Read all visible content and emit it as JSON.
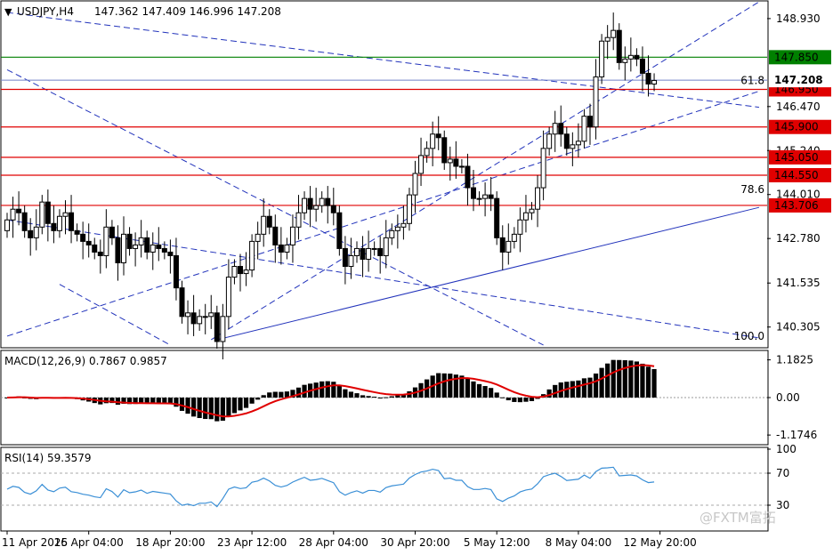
{
  "header": {
    "symbol": "USDJPY,H4",
    "ohlc": "147.362 147.409 146.996 147.208"
  },
  "watermark": "@FXTM富拓",
  "chart_data": {
    "type": "candlestick",
    "price_ticks": [
      "148.930",
      "146.470",
      "145.240",
      "144.010",
      "142.780",
      "141.535",
      "140.305"
    ],
    "price_tick_values": [
      148.93,
      146.47,
      145.24,
      144.01,
      142.78,
      141.535,
      140.305
    ],
    "price_range": [
      139.75,
      149.4
    ],
    "current_price": {
      "label": "147.208",
      "value": 147.208
    },
    "levels": [
      {
        "label": "147.850",
        "value": 147.85,
        "color": "#008000"
      },
      {
        "label": "146.950",
        "value": 146.95,
        "color": "#e00000"
      },
      {
        "label": "145.900",
        "value": 145.9,
        "color": "#e00000"
      },
      {
        "label": "145.050",
        "value": 145.05,
        "color": "#e00000"
      },
      {
        "label": "144.550",
        "value": 144.55,
        "color": "#e00000"
      },
      {
        "label": "143.706",
        "value": 143.706,
        "color": "#e00000"
      }
    ],
    "fib_labels": [
      {
        "label": "61.8",
        "value": 147.05
      },
      {
        "label": "78.6",
        "value": 144.0
      },
      {
        "label": "100.0",
        "value": 139.9
      }
    ],
    "x_labels": [
      "11 Apr 2025",
      "16 Apr 04:00",
      "18 Apr 20:00",
      "23 Apr 12:00",
      "28 Apr 04:00",
      "30 Apr 20:00",
      "5 May 12:00",
      "8 May 04:00",
      "12 May 20:00"
    ],
    "x_label_bar_index": [
      0,
      14,
      28,
      42,
      56,
      70,
      84,
      98,
      112
    ],
    "closes": [
      143.3,
      143.6,
      143.5,
      143.0,
      142.8,
      143.1,
      143.8,
      143.2,
      143.0,
      143.4,
      143.5,
      143.0,
      142.9,
      142.7,
      142.6,
      142.4,
      142.3,
      143.1,
      142.8,
      142.1,
      142.9,
      142.5,
      142.6,
      142.8,
      142.4,
      142.6,
      142.5,
      142.4,
      142.3,
      141.4,
      140.6,
      140.7,
      140.4,
      140.6,
      140.6,
      140.7,
      139.9,
      140.6,
      141.7,
      142.0,
      141.8,
      141.9,
      142.7,
      142.9,
      143.4,
      143.1,
      142.6,
      142.4,
      142.6,
      143.1,
      143.5,
      143.9,
      143.6,
      143.7,
      143.9,
      143.7,
      143.5,
      142.5,
      142.0,
      142.3,
      142.5,
      142.2,
      142.5,
      142.5,
      142.3,
      142.8,
      143.0,
      143.1,
      143.2,
      144.0,
      144.6,
      145.1,
      145.3,
      145.7,
      145.6,
      144.9,
      145.0,
      144.8,
      144.8,
      144.2,
      143.9,
      143.9,
      144.0,
      143.9,
      142.8,
      142.4,
      142.7,
      142.9,
      143.3,
      143.5,
      143.6,
      144.2,
      145.3,
      145.7,
      146.0,
      145.7,
      145.3,
      145.4,
      145.5,
      146.2,
      145.9,
      147.3,
      148.3,
      148.4,
      148.6,
      147.7,
      147.8,
      147.9,
      147.8,
      147.4,
      147.1,
      147.2
    ],
    "trendlines": [
      {
        "name": "upper-channel",
        "style": "dashed",
        "from": [
          35,
          139.95
        ],
        "to": [
          129,
          149.4
        ]
      },
      {
        "name": "lower-channel",
        "style": "dashed",
        "from": [
          0,
          140.05
        ],
        "to": [
          129,
          146.9
        ]
      },
      {
        "name": "support",
        "style": "solid",
        "from": [
          36,
          139.95
        ],
        "to": [
          129,
          143.65
        ]
      },
      {
        "name": "desc-upper",
        "style": "dashed",
        "from": [
          0,
          149.1
        ],
        "to": [
          129,
          146.45
        ]
      },
      {
        "name": "desc-mid",
        "style": "dashed",
        "from": [
          0,
          143.3
        ],
        "to": [
          129,
          140.0
        ]
      },
      {
        "name": "desc-steep-1",
        "style": "dashed",
        "from": [
          0,
          147.5
        ],
        "to": [
          92,
          139.8
        ]
      },
      {
        "name": "desc-steep-2",
        "style": "dashed",
        "from": [
          9,
          141.5
        ],
        "to": [
          28,
          139.8
        ]
      }
    ],
    "macd": {
      "label": "MACD(12,26,9) 0.7867 0.9857",
      "ticks": [
        "1.1825",
        "0.00",
        "-1.1746"
      ],
      "tick_values": [
        1.1825,
        0.0,
        -1.1746
      ],
      "range": [
        -1.45,
        1.45
      ]
    },
    "rsi": {
      "label": "RSI(14) 59.3579",
      "ticks": [
        "100",
        "70",
        "30"
      ],
      "tick_values": [
        100,
        70,
        30
      ],
      "range": [
        0,
        100
      ]
    }
  }
}
